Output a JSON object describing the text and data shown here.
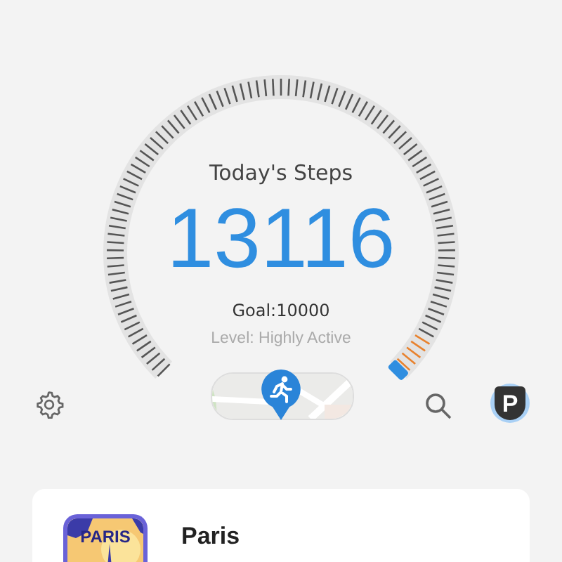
{
  "gauge": {
    "title": "Today's Steps",
    "steps": "13116",
    "goal": "Goal:10000",
    "activity_level": "Level: Highly Active",
    "level": 1
  },
  "toolbar": {
    "avatar_letter": "P"
  },
  "card": {
    "badge_text": "PARIS",
    "title": "Paris"
  }
}
